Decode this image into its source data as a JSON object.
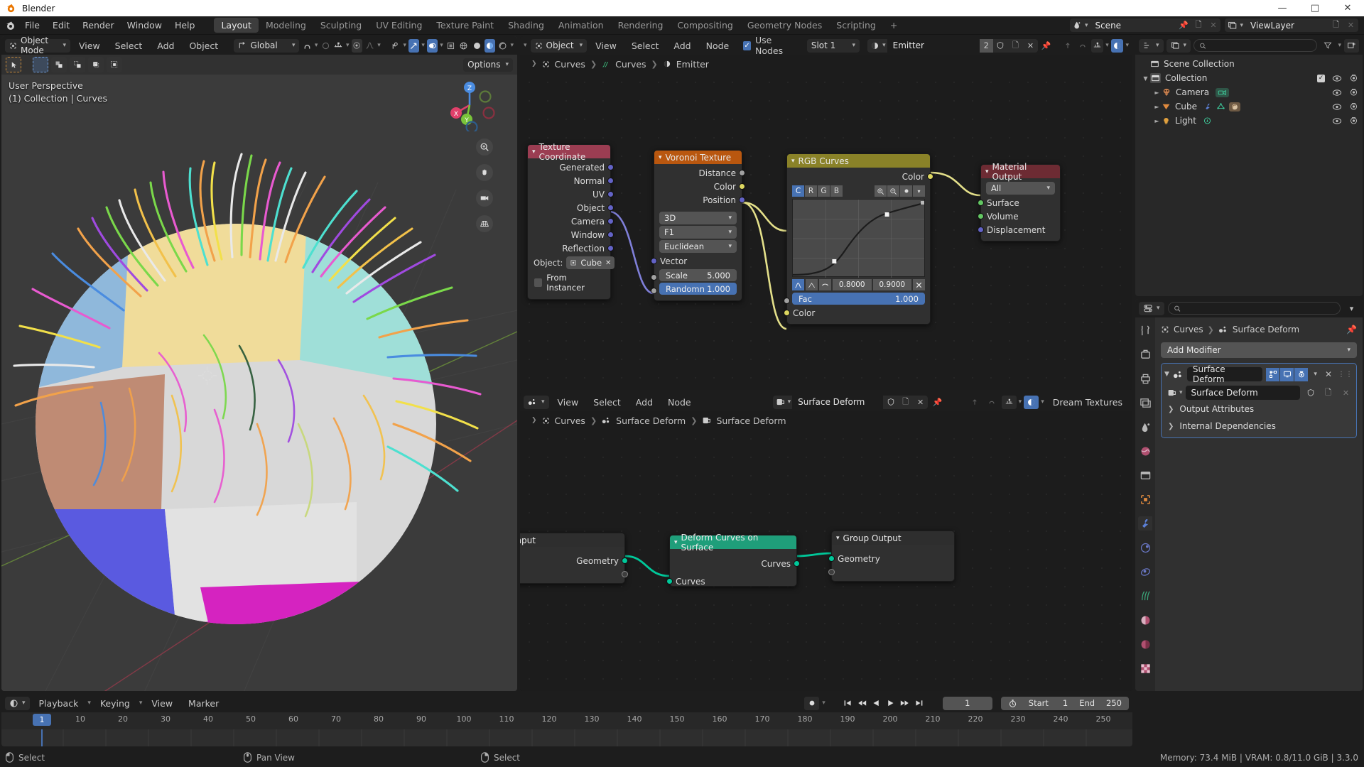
{
  "window": {
    "title": "Blender"
  },
  "topbar": {
    "menus": [
      "File",
      "Edit",
      "Render",
      "Window",
      "Help"
    ],
    "workspace_tabs": [
      "Layout",
      "Modeling",
      "Sculpting",
      "UV Editing",
      "Texture Paint",
      "Shading",
      "Animation",
      "Rendering",
      "Compositing",
      "Geometry Nodes",
      "Scripting"
    ],
    "active_workspace": "Layout",
    "add_tab": "+",
    "scene": "Scene",
    "view_layer": "ViewLayer"
  },
  "viewport": {
    "mode": "Object Mode",
    "menus": [
      "View",
      "Select",
      "Add",
      "Object"
    ],
    "transform_orientation": "Global",
    "options_label": "Options",
    "overlay_line1": "User Perspective",
    "overlay_line2": "(1) Collection | Curves",
    "gizmo_axes": [
      "X",
      "Y",
      "Z"
    ]
  },
  "shader_editor": {
    "id_type": "Object",
    "menus": [
      "View",
      "Select",
      "Add",
      "Node"
    ],
    "use_nodes_label": "Use Nodes",
    "use_nodes_checked": true,
    "slot": "Slot 1",
    "material": "Emitter",
    "material_users": "2",
    "breadcrumb": [
      "Curves",
      "Curves",
      "Emitter"
    ],
    "nodes": [
      {
        "name": "Texture Coordinate",
        "header_color": "#9b3d52",
        "outputs": [
          "Generated",
          "Normal",
          "UV",
          "Object",
          "Camera",
          "Window",
          "Reflection"
        ],
        "object_label": "Object:",
        "object_value": "Cube",
        "from_instancer_label": "From Instancer"
      },
      {
        "name": "Voronoi Texture",
        "header_color": "#b9570f",
        "outputs": [
          "Distance",
          "Color",
          "Position"
        ],
        "dropdowns": [
          "3D",
          "F1",
          "Euclidean"
        ],
        "vector_input": "Vector",
        "props": [
          {
            "label": "Scale",
            "value": "5.000",
            "highlight": false
          },
          {
            "label": "Randomn",
            "value": "1.000",
            "highlight": true
          }
        ]
      },
      {
        "name": "RGB Curves",
        "header_color": "#8a8228",
        "outputs": [
          "Color"
        ],
        "channel_tabs": [
          "C",
          "R",
          "G",
          "B"
        ],
        "active_channel": "C",
        "handle_x": "0.8000",
        "handle_y": "0.9000",
        "fac_label": "Fac",
        "fac_value": "1.000",
        "input_color": "Color"
      },
      {
        "name": "Material Output",
        "header_color": "#6d2b33",
        "target": "All",
        "inputs": [
          "Surface",
          "Volume",
          "Displacement"
        ]
      }
    ]
  },
  "geonodes_editor": {
    "menus": [
      "View",
      "Select",
      "Add",
      "Node"
    ],
    "node_group": "Surface Deform",
    "addon_label": "Dream Textures",
    "breadcrumb": [
      "Curves",
      "Surface Deform",
      "Surface Deform"
    ],
    "nodes": [
      {
        "name": "Group Input",
        "header_color": "#2c2c2c",
        "outputs": [
          "Geometry"
        ]
      },
      {
        "name": "Deform Curves on Surface",
        "header_color": "#1f9e7a",
        "outputs": [
          "Curves"
        ],
        "inputs": [
          "Curves"
        ]
      },
      {
        "name": "Group Output",
        "header_color": "#2c2c2c",
        "inputs": [
          "Geometry"
        ]
      }
    ]
  },
  "outliner": {
    "search_placeholder": "",
    "rows": [
      {
        "label": "Scene Collection",
        "icon": "collection-icon",
        "depth": 0,
        "expanded": false,
        "show_toggles": false
      },
      {
        "label": "Collection",
        "icon": "collection-icon",
        "depth": 1,
        "expanded": true,
        "show_toggles": true,
        "checkbox": true
      },
      {
        "label": "Camera",
        "icon": "camera-object-icon",
        "depth": 2,
        "expanded": false,
        "show_toggles": true,
        "data_icons": [
          "camera-data-icon"
        ]
      },
      {
        "label": "Cube",
        "icon": "mesh-object-icon",
        "depth": 2,
        "expanded": false,
        "show_toggles": true,
        "data_icons": [
          "modifier-icon",
          "mesh-data-icon",
          "material-icon"
        ]
      },
      {
        "label": "Light",
        "icon": "light-object-icon",
        "depth": 2,
        "expanded": false,
        "show_toggles": true,
        "data_icons": [
          "light-data-icon"
        ]
      }
    ]
  },
  "properties": {
    "search_placeholder": "",
    "breadcrumb": [
      "Curves",
      "Surface Deform"
    ],
    "add_modifier_label": "Add Modifier",
    "modifier": {
      "name": "Surface Deform",
      "node_group": "Surface Deform",
      "subpanels": [
        "Output Attributes",
        "Internal Dependencies"
      ]
    },
    "tabs": [
      "tool-icon",
      "render-icon",
      "output-icon",
      "view-layer-icon",
      "scene-icon",
      "world-icon",
      "collection-icon",
      "object-icon",
      "modifier-icon",
      "physics-icon",
      "constraint-icon",
      "particles-icon",
      "data-icon",
      "material-icon",
      "texture-icon"
    ],
    "active_tab": "modifier-icon"
  },
  "timeline": {
    "menus": [
      "Playback",
      "Keying",
      "View",
      "Marker"
    ],
    "current_frame": "1",
    "start_label": "Start",
    "start_value": "1",
    "end_label": "End",
    "end_value": "250",
    "ticks": [
      1,
      10,
      20,
      30,
      40,
      50,
      60,
      70,
      80,
      90,
      100,
      110,
      120,
      130,
      140,
      150,
      160,
      170,
      180,
      190,
      200,
      210,
      220,
      230,
      240,
      250
    ]
  },
  "statusbar": {
    "items": [
      {
        "icon": "mouse-left-icon",
        "label": "Select"
      },
      {
        "icon": "mouse-middle-icon",
        "label": "Pan View"
      },
      {
        "icon": "mouse-right-icon",
        "label": "Select"
      }
    ],
    "stats": "Memory: 73.4 MiB | VRAM: 0.8/11.0 GiB | 3.3.0"
  },
  "colors": {
    "accent_blue": "#4772b3",
    "geometry_green": "#00c89a",
    "yellow_socket": "#ddd760",
    "purple_socket": "#6363c7",
    "grey_socket": "#a1a1a1",
    "green_socket": "#63c763"
  }
}
